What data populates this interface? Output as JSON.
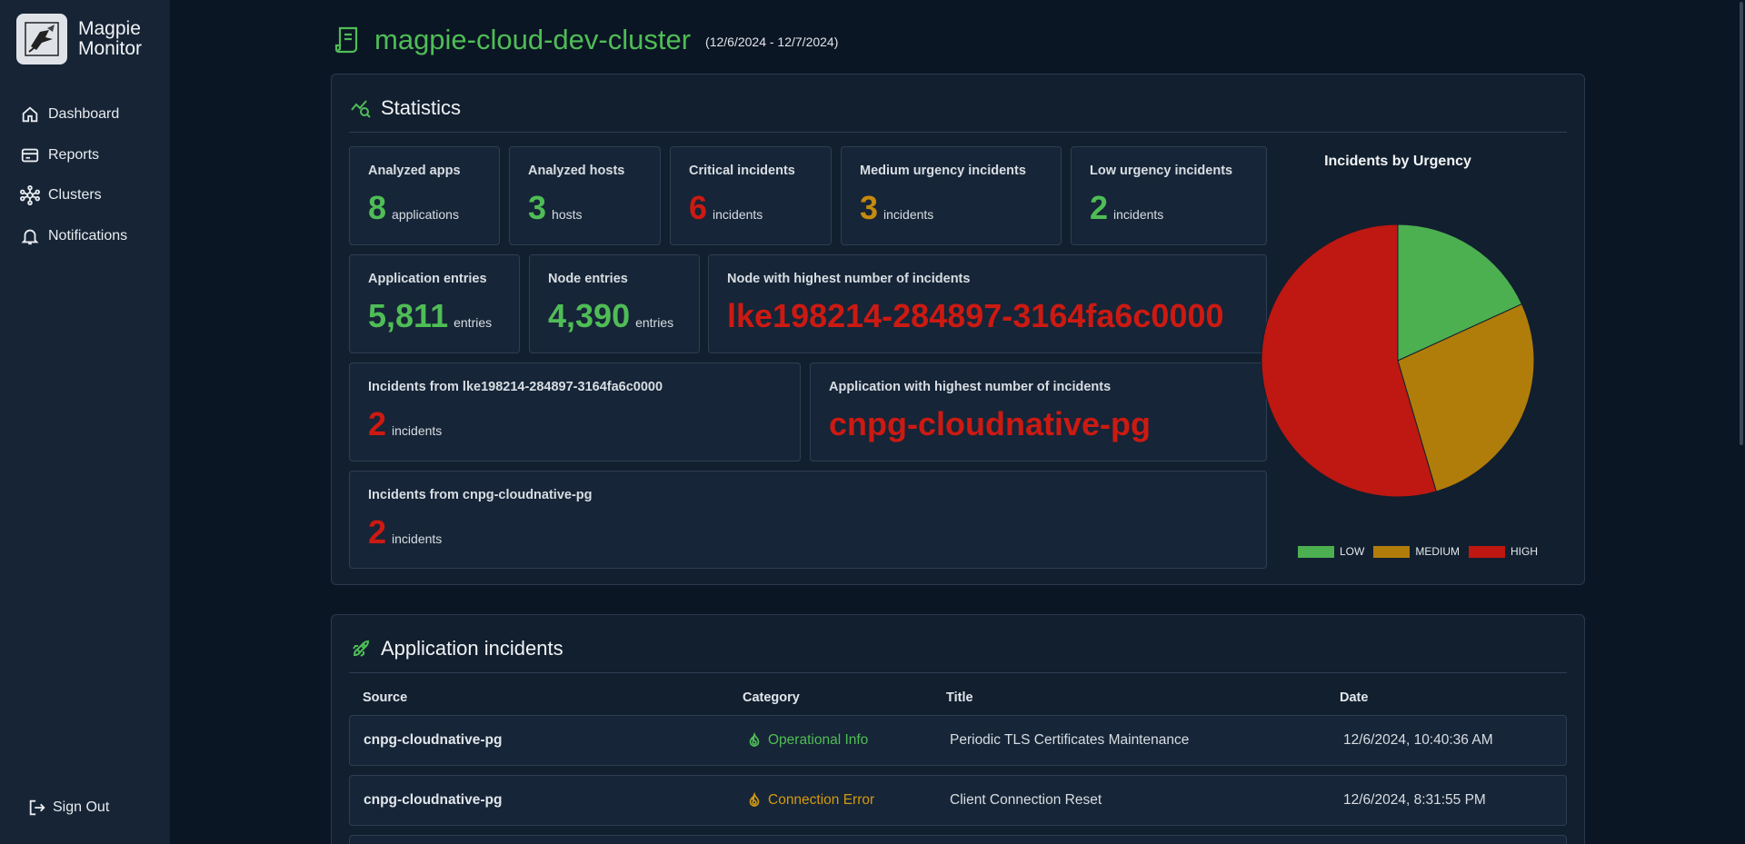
{
  "brand": {
    "name_line1": "Magpie",
    "name_line2": "Monitor"
  },
  "nav": [
    {
      "label": "Dashboard",
      "icon": "home-icon"
    },
    {
      "label": "Reports",
      "icon": "reports-icon"
    },
    {
      "label": "Clusters",
      "icon": "clusters-icon"
    },
    {
      "label": "Notifications",
      "icon": "bell-icon"
    }
  ],
  "signout": {
    "label": "Sign Out",
    "icon": "sign-out-icon"
  },
  "header": {
    "title": "magpie-cloud-dev-cluster",
    "date_range": "(12/6/2024 - 12/7/2024)"
  },
  "statistics": {
    "title": "Statistics",
    "analyzed_apps": {
      "label": "Analyzed apps",
      "value": "8",
      "unit": "applications"
    },
    "analyzed_hosts": {
      "label": "Analyzed hosts",
      "value": "3",
      "unit": "hosts"
    },
    "critical": {
      "label": "Critical incidents",
      "value": "6",
      "unit": "incidents"
    },
    "medium": {
      "label": "Medium urgency incidents",
      "value": "3",
      "unit": "incidents"
    },
    "low": {
      "label": "Low urgency incidents",
      "value": "2",
      "unit": "incidents"
    },
    "app_entries": {
      "label": "Application entries",
      "value": "5,811",
      "unit": "entries"
    },
    "node_entries": {
      "label": "Node entries",
      "value": "4,390",
      "unit": "entries"
    },
    "top_node": {
      "label": "Node with highest number of incidents",
      "value": "lke198214-284897-3164fa6c0000"
    },
    "node_incidents": {
      "label": "Incidents from lke198214-284897-3164fa6c0000",
      "value": "2",
      "unit": "incidents"
    },
    "top_app": {
      "label": "Application with highest number of incidents",
      "value": "cnpg-cloudnative-pg"
    },
    "app_incidents": {
      "label": "Incidents from cnpg-cloudnative-pg",
      "value": "2",
      "unit": "incidents"
    }
  },
  "chart_data": {
    "type": "pie",
    "title": "Incidents by Urgency",
    "categories": [
      "LOW",
      "MEDIUM",
      "HIGH"
    ],
    "values": [
      2,
      3,
      6
    ],
    "colors": [
      "#4caf50",
      "#b07d0a",
      "#bf1711"
    ],
    "legend": "bottom"
  },
  "incidents": {
    "title": "Application incidents",
    "columns": [
      "Source",
      "Category",
      "Title",
      "Date"
    ],
    "rows": [
      {
        "source": "cnpg-cloudnative-pg",
        "category": "Operational Info",
        "category_color": "#4fbd56",
        "title": "Periodic TLS Certificates Maintenance",
        "date": "12/6/2024, 10:40:36 AM"
      },
      {
        "source": "cnpg-cloudnative-pg",
        "category": "Connection Error",
        "category_color": "#d39a12",
        "title": "Client Connection Reset",
        "date": "12/6/2024, 8:31:55 PM"
      }
    ]
  },
  "colors": {
    "accent": "#4fbd56",
    "critical": "#cc1a12",
    "medium": "#c48a0f"
  }
}
